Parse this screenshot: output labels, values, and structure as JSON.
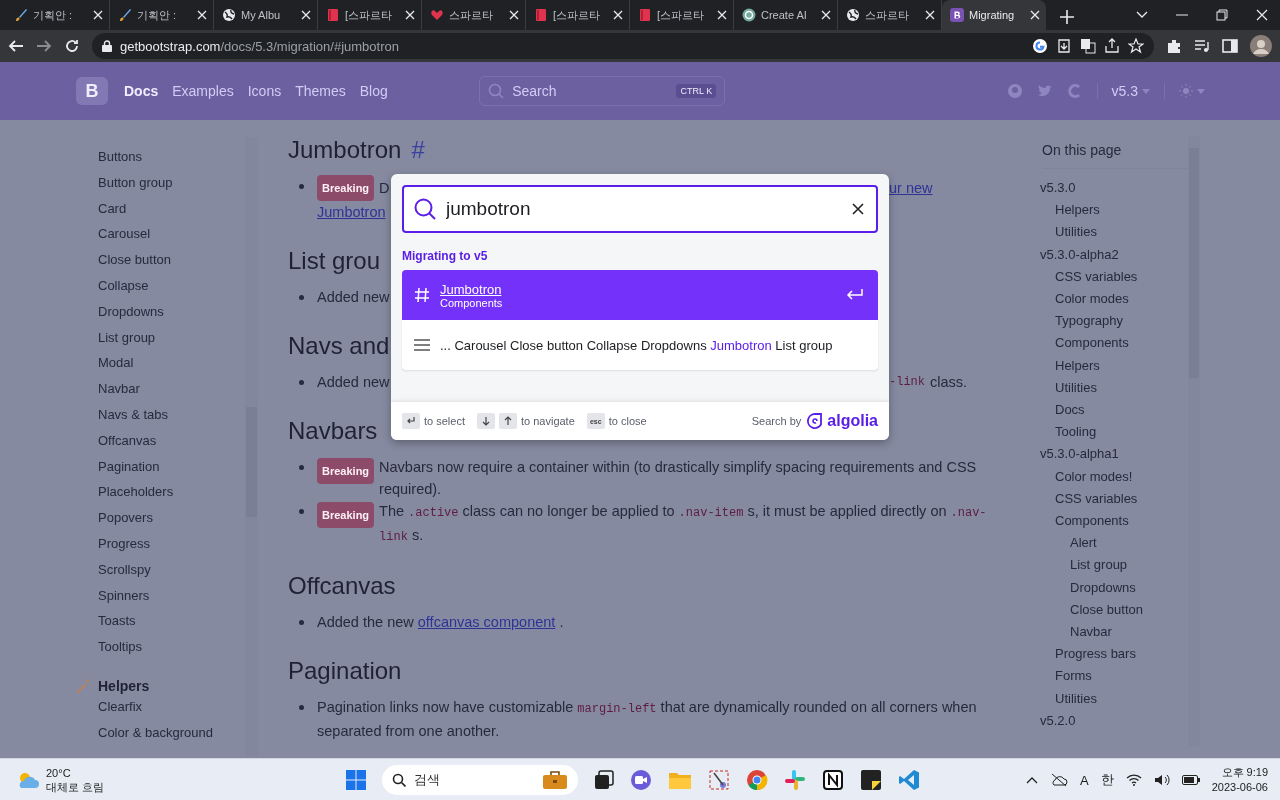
{
  "browser": {
    "tabs": [
      {
        "title": "기획안 :",
        "selected": false
      },
      {
        "title": "기획안 :",
        "selected": false
      },
      {
        "title": "My Albu",
        "selected": false
      },
      {
        "title": "[스파르타",
        "selected": false
      },
      {
        "title": "스파르타",
        "selected": false
      },
      {
        "title": "[스파르타",
        "selected": false
      },
      {
        "title": "[스파르타",
        "selected": false
      },
      {
        "title": "Create AI",
        "selected": false
      },
      {
        "title": "스파르타",
        "selected": false
      },
      {
        "title": "Migrating",
        "selected": true
      }
    ],
    "address": {
      "host": "getbootstrap.com",
      "path": "/docs/5.3/migration/#jumbotron"
    }
  },
  "navbar": {
    "logo": "B",
    "links": [
      {
        "label": "Docs",
        "selected": true
      },
      {
        "label": "Examples",
        "selected": false
      },
      {
        "label": "Icons",
        "selected": false
      },
      {
        "label": "Themes",
        "selected": false
      },
      {
        "label": "Blog",
        "selected": false
      }
    ],
    "search": {
      "placeholder": "Search",
      "keys": [
        "CTRL",
        "K"
      ]
    },
    "version": "v5.3"
  },
  "sidebar": {
    "items": [
      "Buttons",
      "Button group",
      "Card",
      "Carousel",
      "Close button",
      "Collapse",
      "Dropdowns",
      "List group",
      "Modal",
      "Navbar",
      "Navs & tabs",
      "Offcanvas",
      "Pagination",
      "Placeholders",
      "Popovers",
      "Progress",
      "Scrollspy",
      "Spinners",
      "Toasts",
      "Tooltips"
    ],
    "group": {
      "title": "Helpers",
      "items": [
        "Clearfix",
        "Color & background"
      ]
    }
  },
  "content": {
    "sections": [
      {
        "heading": "Jumbotron",
        "anchor": "#",
        "bullets": [
          {
            "lines": [
              {
                "left": [
                  {
                    "kind": "badge",
                    "text": "Breaking"
                  },
                  {
                    "kind": "text",
                    "text": "D"
                  }
                ],
                "right": [
                  {
                    "kind": "link",
                    "text": "ur new"
                  }
                ]
              },
              {
                "left": [
                  {
                    "kind": "link",
                    "text": "Jumbotron"
                  }
                ]
              }
            ]
          }
        ]
      },
      {
        "heading": "List grou",
        "bullets": [
          {
            "lines": [
              {
                "left": [
                  {
                    "kind": "text",
                    "text": "Added new"
                  }
                ]
              }
            ]
          }
        ]
      },
      {
        "heading": "Navs and",
        "bullets": [
          {
            "lines": [
              {
                "left": [
                  {
                    "kind": "text",
                    "text": "Added new"
                  }
                ],
                "right": [
                  {
                    "kind": "code",
                    "text": "-link"
                  },
                  {
                    "kind": "text",
                    "text": "class."
                  }
                ]
              }
            ]
          }
        ]
      },
      {
        "heading": "Navbars",
        "bullets": [
          {
            "parts": [
              {
                "kind": "badge",
                "text": "Breaking"
              },
              {
                "kind": "text",
                "text": "Navbars now require a container within (to drastically simplify spacing requirements and CSS required)."
              }
            ]
          },
          {
            "parts": [
              {
                "kind": "badge",
                "text": "Breaking"
              },
              {
                "kind": "text",
                "text": "The"
              },
              {
                "kind": "code",
                "text": ".active"
              },
              {
                "kind": "text",
                "text": "class can no longer be applied to"
              },
              {
                "kind": "code",
                "text": ".nav-item"
              },
              {
                "kind": "text",
                "text": "s, it must be applied directly on"
              },
              {
                "kind": "code",
                "text": ".nav-link"
              },
              {
                "kind": "text",
                "text": "s."
              }
            ]
          }
        ]
      },
      {
        "heading": "Offcanvas",
        "bullets": [
          {
            "parts": [
              {
                "kind": "text",
                "text": "Added the new"
              },
              {
                "kind": "link",
                "text": "offcanvas component"
              },
              {
                "kind": "text",
                "text": "."
              }
            ]
          }
        ]
      },
      {
        "heading": "Pagination",
        "bullets": [
          {
            "parts": [
              {
                "kind": "text",
                "text": "Pagination links now have customizable"
              },
              {
                "kind": "code",
                "text": "margin-left"
              },
              {
                "kind": "text",
                "text": "that are dynamically rounded on all corners when separated from one another."
              }
            ]
          }
        ]
      }
    ]
  },
  "toc": {
    "title": "On this page",
    "items": [
      {
        "label": "v5.3.0",
        "children": [
          {
            "label": "Helpers"
          },
          {
            "label": "Utilities"
          }
        ]
      },
      {
        "label": "v5.3.0-alpha2",
        "children": [
          {
            "label": "CSS variables"
          },
          {
            "label": "Color modes"
          },
          {
            "label": "Typography"
          },
          {
            "label": "Components"
          },
          {
            "label": "Helpers"
          },
          {
            "label": "Utilities"
          },
          {
            "label": "Docs"
          },
          {
            "label": "Tooling"
          }
        ]
      },
      {
        "label": "v5.3.0-alpha1",
        "children": [
          {
            "label": "Color modes!"
          },
          {
            "label": "CSS variables"
          },
          {
            "label": "Components",
            "children": [
              {
                "label": "Alert"
              },
              {
                "label": "List group"
              },
              {
                "label": "Dropdowns"
              },
              {
                "label": "Close button"
              },
              {
                "label": "Navbar"
              }
            ]
          },
          {
            "label": "Progress bars"
          },
          {
            "label": "Forms"
          },
          {
            "label": "Utilities"
          }
        ]
      },
      {
        "label": "v5.2.0"
      }
    ]
  },
  "search_modal": {
    "query": "jumbotron",
    "section": "Migrating to v5",
    "hits": [
      {
        "kind": "heading",
        "title": "Jumbotron",
        "subtitle": "Components",
        "selected": true
      },
      {
        "kind": "content",
        "before": "... Carousel Close button Collapse Dropdowns",
        "highlight": "Jumbotron",
        "after": "List group",
        "selected": false
      }
    ],
    "footer": {
      "commands": [
        {
          "keys": [
            {
              "kind": "enter"
            }
          ],
          "label": "to select"
        },
        {
          "keys": [
            {
              "kind": "down"
            },
            {
              "kind": "up"
            }
          ],
          "label": "to navigate"
        },
        {
          "keys": [
            {
              "kind": "label",
              "text": "esc"
            }
          ],
          "label": "to close"
        }
      ],
      "search_by": "Search by",
      "brand": "algolia"
    }
  },
  "taskbar": {
    "weather": {
      "temp": "20°C",
      "desc": "대체로 흐림"
    },
    "search": "검색",
    "ime": [
      "A",
      "한"
    ],
    "time": "오후 9:19",
    "date": "2023-06-06"
  }
}
